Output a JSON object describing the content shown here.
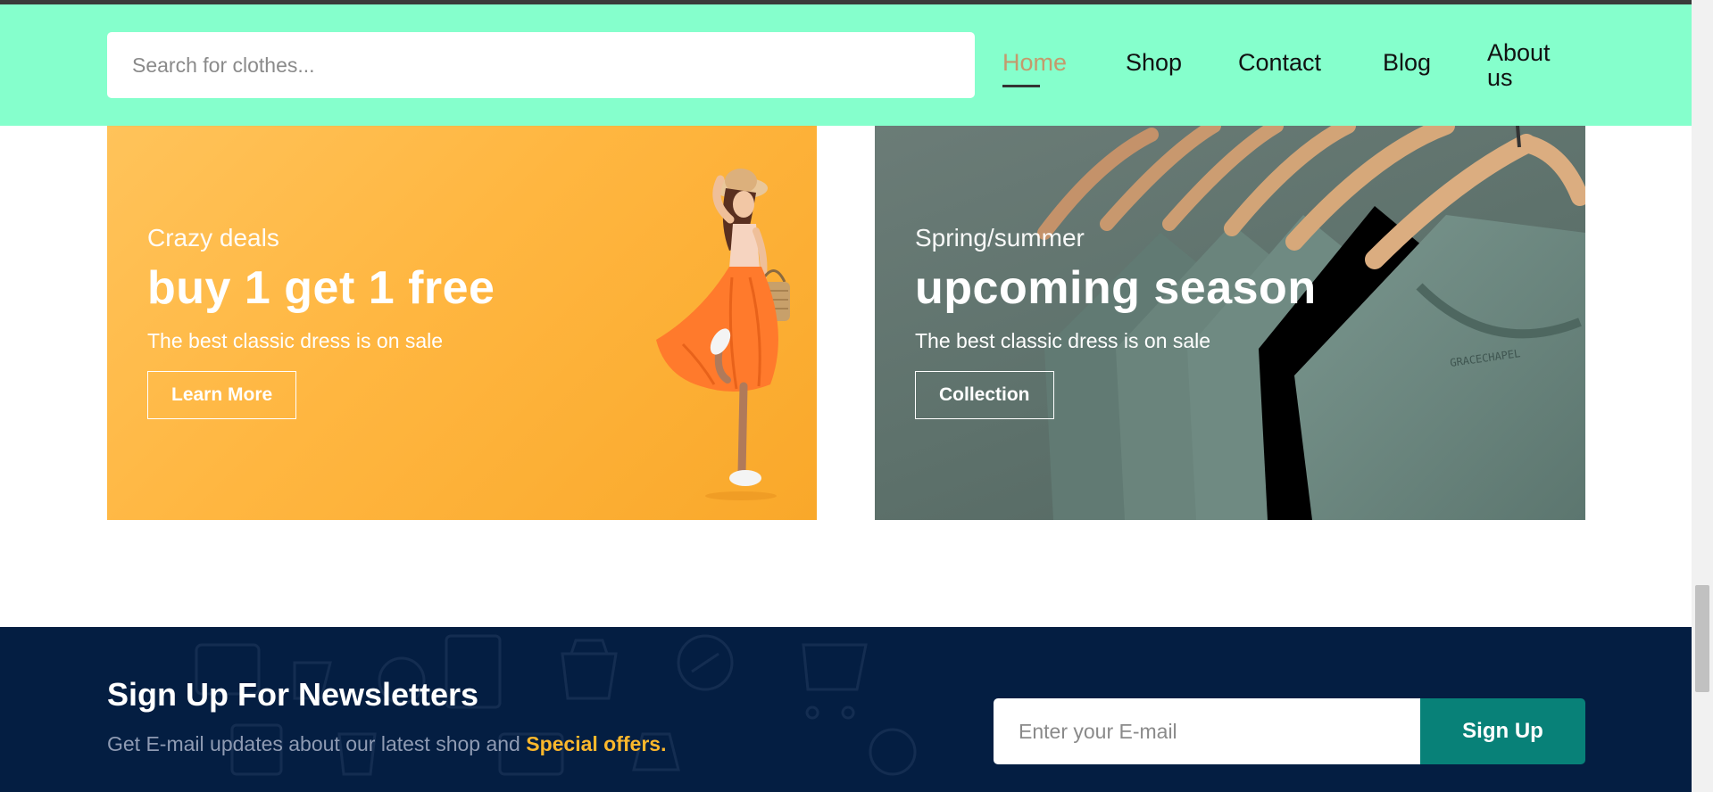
{
  "header": {
    "search_placeholder": "Search for clothes...",
    "nav": [
      {
        "label": "Home",
        "active": true
      },
      {
        "label": "Shop",
        "active": false
      },
      {
        "label": "Contact",
        "active": false
      },
      {
        "label": "Blog",
        "active": false
      },
      {
        "label": "About us",
        "active": false
      }
    ]
  },
  "banners": [
    {
      "subtitle": "Crazy deals",
      "title": "buy 1 get 1 free",
      "description": "The best classic dress is on sale",
      "button": "Learn More"
    },
    {
      "subtitle": "Spring/summer",
      "title": "upcoming season",
      "description": "The best classic dress is on sale",
      "button": "Collection",
      "tag_text": "GRACECHAPEL"
    }
  ],
  "newsletter": {
    "title": "Sign Up For Newsletters",
    "description_prefix": "Get E-mail updates about our latest shop and ",
    "description_highlight": "Special offers.",
    "email_placeholder": "Enter your E-mail",
    "button": "Sign Up"
  },
  "colors": {
    "header_bg": "#85ffcc",
    "active_nav": "#c49a6c",
    "newsletter_bg": "#041e42",
    "signup_button": "#088178",
    "highlight": "#fbb72c"
  }
}
